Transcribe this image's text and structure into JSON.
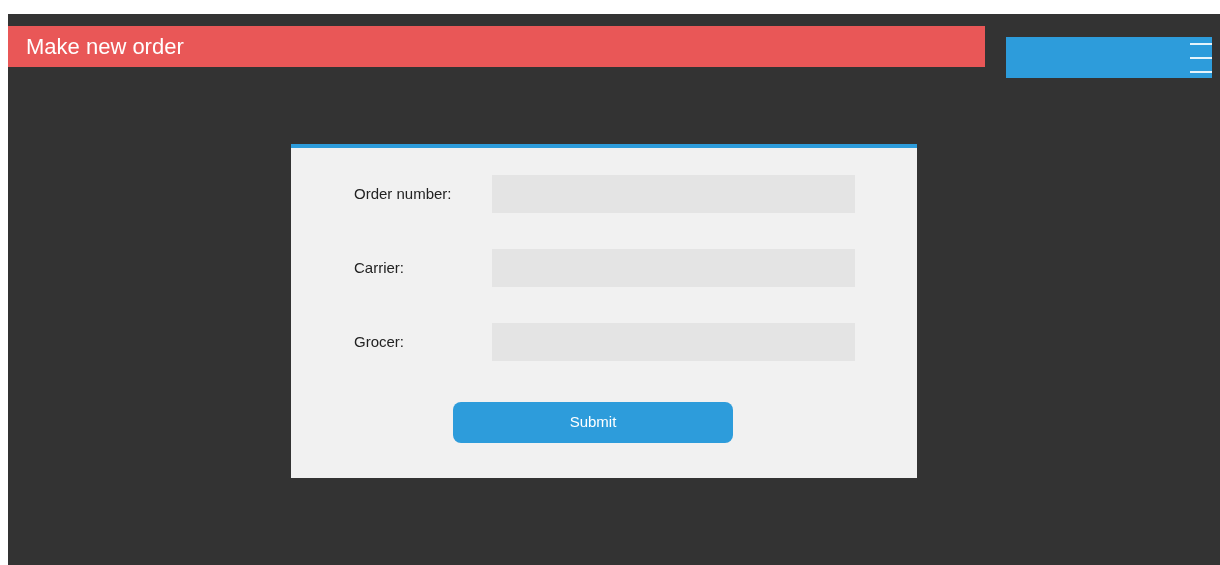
{
  "header": {
    "title": "Make new order"
  },
  "form": {
    "fields": [
      {
        "label": "Order number:"
      },
      {
        "label": "Carrier:"
      },
      {
        "label": "Grocer:"
      }
    ],
    "submit": "Submit"
  }
}
